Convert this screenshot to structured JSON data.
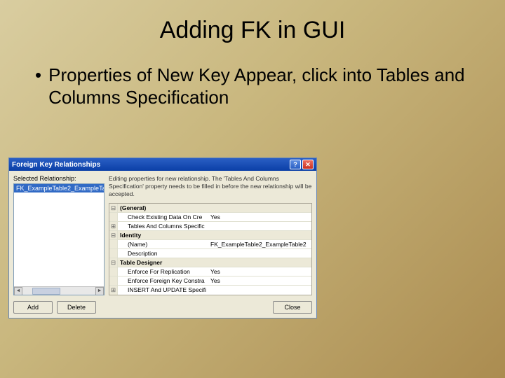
{
  "slide": {
    "title": "Adding FK in GUI",
    "bullet": "Properties of New Key Appear, click into Tables and Columns Specification"
  },
  "dialog": {
    "title": "Foreign Key Relationships",
    "selected_label": "Selected Relationship:",
    "list_item": "FK_ExampleTable2_ExampleTab",
    "hint": "Editing properties for new relationship. The 'Tables And Columns Specification' property needs to be filled in before the new relationship will be accepted.",
    "grid": {
      "cat_general": "(General)",
      "check_existing_label": "Check Existing Data On Cre",
      "check_existing_value": "Yes",
      "tables_cols_label": "Tables And Columns Specific",
      "cat_identity": "Identity",
      "name_label": "(Name)",
      "name_value": "FK_ExampleTable2_ExampleTable2",
      "description_label": "Description",
      "cat_designer": "Table Designer",
      "enforce_repl_label": "Enforce For Replication",
      "enforce_repl_value": "Yes",
      "enforce_fk_label": "Enforce Foreign Key Constra",
      "enforce_fk_value": "Yes",
      "insert_update_label": "INSERT And UPDATE Specifi"
    },
    "buttons": {
      "add": "Add",
      "delete": "Delete",
      "close": "Close"
    }
  }
}
